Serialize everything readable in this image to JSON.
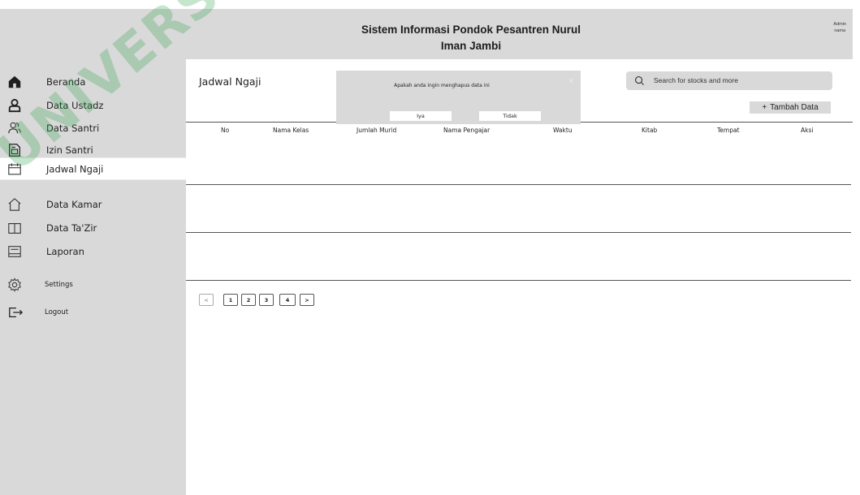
{
  "header": {
    "title_line1": "Sistem Informasi Pondok Pesantren Nurul",
    "title_line2": "Iman Jambi",
    "user_role": "Admin",
    "user_name": "nama"
  },
  "sidebar": {
    "items": [
      {
        "label": "Beranda",
        "icon": "home-icon"
      },
      {
        "label": "Data Ustadz",
        "icon": "user-icon"
      },
      {
        "label": "Data Santri",
        "icon": "users-icon"
      },
      {
        "label": "Izin Santri",
        "icon": "document-icon"
      },
      {
        "label": "Jadwal Ngaji",
        "icon": "calendar-icon",
        "active": true
      },
      {
        "label": "Data Kamar",
        "icon": "house-outline-icon"
      },
      {
        "label": "Data Ta'Zir",
        "icon": "book-icon"
      },
      {
        "label": "Laporan",
        "icon": "report-icon"
      },
      {
        "label": "Settings",
        "icon": "gear-icon"
      },
      {
        "label": "Logout",
        "icon": "logout-icon"
      }
    ]
  },
  "main": {
    "page_title": "Jadwal Ngaji",
    "search_placeholder": "Search for stocks and more",
    "add_button_icon": "+",
    "add_button_label": "Tambah Data",
    "columns": [
      "No",
      "Nama Kelas",
      "Jumlah Murid",
      "Nama Pengajar",
      "Waktu",
      "Kitab",
      "Tempat",
      "Aksi"
    ],
    "rows": [
      [],
      [],
      []
    ],
    "pagination": {
      "prev": "<",
      "pages": [
        "1",
        "2",
        "3",
        "4"
      ],
      "next": ">"
    }
  },
  "dialog": {
    "message": "Apakah anda ingin menghapus data ini",
    "close": "×",
    "confirm_label": "Iya",
    "cancel_label": "Tidak"
  },
  "watermark": "UNIVERSITAS",
  "colors": {
    "panel": "#d9d9d9",
    "watermark": "#2da04b",
    "active_item": "#ffffff"
  }
}
